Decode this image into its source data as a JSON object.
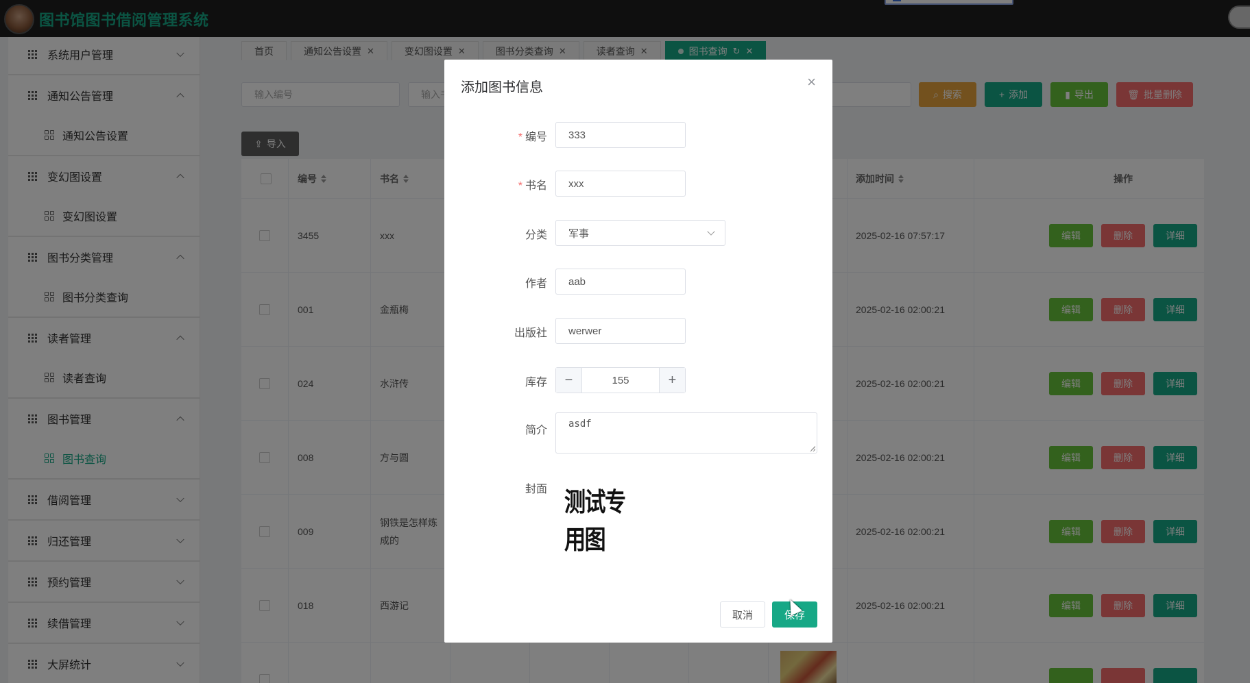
{
  "app": {
    "title": "图书馆图书借阅管理系统"
  },
  "sidebar": {
    "groups": [
      {
        "label": "系统用户管理",
        "expanded": false,
        "sub": []
      },
      {
        "label": "通知公告管理",
        "expanded": true,
        "sub": [
          "通知公告设置"
        ]
      },
      {
        "label": "变幻图设置",
        "expanded": true,
        "sub": [
          "变幻图设置"
        ]
      },
      {
        "label": "图书分类管理",
        "expanded": true,
        "sub": [
          "图书分类查询"
        ]
      },
      {
        "label": "读者管理",
        "expanded": true,
        "sub": [
          "读者查询"
        ]
      },
      {
        "label": "图书管理",
        "expanded": true,
        "sub": [
          "图书查询"
        ]
      },
      {
        "label": "借阅管理",
        "expanded": false,
        "sub": []
      },
      {
        "label": "归还管理",
        "expanded": false,
        "sub": []
      },
      {
        "label": "预约管理",
        "expanded": false,
        "sub": []
      },
      {
        "label": "续借管理",
        "expanded": false,
        "sub": []
      },
      {
        "label": "大屏统计",
        "expanded": false,
        "sub": []
      }
    ]
  },
  "tabs": [
    {
      "label": "首页",
      "closable": false,
      "active": false
    },
    {
      "label": "通知公告设置",
      "closable": true,
      "active": false
    },
    {
      "label": "变幻图设置",
      "closable": true,
      "active": false
    },
    {
      "label": "图书分类查询",
      "closable": true,
      "active": false
    },
    {
      "label": "读者查询",
      "closable": true,
      "active": false
    },
    {
      "label": "图书查询",
      "closable": true,
      "active": true
    }
  ],
  "search": {
    "placeholder_id": "输入编号",
    "placeholder_2": "输入书",
    "btn_search": "搜索",
    "btn_add": "添加",
    "btn_export": "导出",
    "btn_batch_delete": "批量删除",
    "btn_import": "导入"
  },
  "table": {
    "headers": {
      "id": "编号",
      "name": "书名",
      "added": "添加时间",
      "ops": "操作"
    },
    "rows": [
      {
        "id": "3455",
        "name": "xxx",
        "added": "2025-02-16 07:57:17"
      },
      {
        "id": "001",
        "name": "金瓶梅",
        "added": "2025-02-16 02:00:21"
      },
      {
        "id": "024",
        "name": "水浒传",
        "added": "2025-02-16 02:00:21"
      },
      {
        "id": "008",
        "name": "方与圆",
        "added": "2025-02-16 02:00:21"
      },
      {
        "id": "009",
        "name": "钢铁是怎样炼成的",
        "added": "2025-02-16 02:00:21"
      },
      {
        "id": "018",
        "name": "西游记",
        "added": "2025-02-16 02:00:21"
      }
    ],
    "op_labels": {
      "edit": "编辑",
      "delete": "删除",
      "detail": "详细"
    }
  },
  "dialog": {
    "title": "添加图书信息",
    "close": "×",
    "fields": {
      "id": {
        "label": "编号",
        "value": "333",
        "required": true
      },
      "name": {
        "label": "书名",
        "value": "xxx",
        "required": true
      },
      "category": {
        "label": "分类",
        "value": "军事"
      },
      "author": {
        "label": "作者",
        "value": "aab"
      },
      "publisher": {
        "label": "出版社",
        "value": "werwer"
      },
      "stock": {
        "label": "库存",
        "value": "155"
      },
      "intro": {
        "label": "简介",
        "value": "asdf"
      },
      "cover": {
        "label": "封面",
        "image_text": "测试专用图"
      }
    },
    "btn_cancel": "取消",
    "btn_save": "保存"
  },
  "colors": {
    "primary": "#17a886",
    "warning": "#e6a23c",
    "success": "#67c23a",
    "danger": "#f56c6c",
    "topbar": "#1f1f1f"
  },
  "icons": [
    "grid-icon",
    "chevron-icon",
    "search-icon",
    "plus-icon",
    "chart-icon",
    "trash-icon",
    "upload-icon",
    "close-icon",
    "refresh-icon",
    "minus-icon",
    "caret-down-icon",
    "sort-icon"
  ]
}
